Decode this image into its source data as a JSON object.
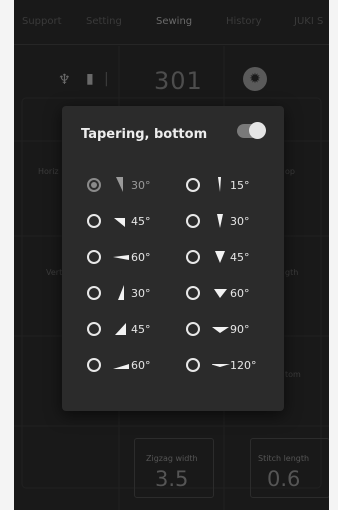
{
  "tabs": [
    "Support",
    "Setting",
    "Sewing",
    "History",
    "JUKI S"
  ],
  "active_tab_index": 2,
  "toolbar": {
    "icons": [
      "needle-icon",
      "presser-foot-icon"
    ],
    "stitch_number": "301",
    "settings_icon": "gear-icon"
  },
  "background_labels": {
    "left_1": "Horiz",
    "right_1": "op",
    "left_2": "Vert",
    "right_2": "gth",
    "right_3": "tom"
  },
  "bottom": {
    "zigzag_label": "Zigzag width",
    "zigzag_value": "3.5",
    "stitch_label": "Stitch length",
    "stitch_value": "0.6"
  },
  "modal": {
    "title": "Tapering, bottom",
    "toggle_on": true,
    "options": [
      {
        "label": "30°",
        "shape": "pointed-wedge",
        "selected": true
      },
      {
        "label": "15°",
        "shape": "narrow-wedge",
        "selected": false
      },
      {
        "label": "45°",
        "shape": "pointed-wedge",
        "selected": false
      },
      {
        "label": "30°",
        "shape": "narrow-wedge",
        "selected": false
      },
      {
        "label": "60°",
        "shape": "pointed-wedge",
        "selected": false
      },
      {
        "label": "45°",
        "shape": "narrow-wedge",
        "selected": false
      },
      {
        "label": "30°",
        "shape": "flat-wedge",
        "selected": false
      },
      {
        "label": "60°",
        "shape": "narrow-wedge",
        "selected": false
      },
      {
        "label": "45°",
        "shape": "flat-wedge",
        "selected": false
      },
      {
        "label": "90°",
        "shape": "narrow-wedge",
        "selected": false
      },
      {
        "label": "60°",
        "shape": "flat-wedge",
        "selected": false
      },
      {
        "label": "120°",
        "shape": "narrow-wedge",
        "selected": false
      }
    ]
  },
  "colors": {
    "modal_bg": "#2b2b2b",
    "screen_bg": "#191919",
    "text_primary": "#ededed",
    "selected_muted": "#8a8a8a"
  }
}
